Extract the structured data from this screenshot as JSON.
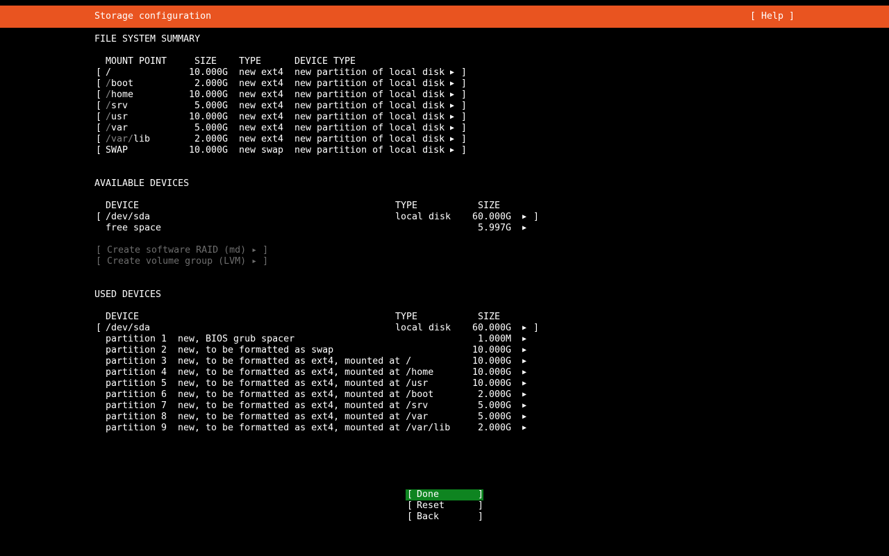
{
  "header": {
    "title": "Storage configuration",
    "help_label": "[ Help ]"
  },
  "fs_summary": {
    "title": "FILE SYSTEM SUMMARY",
    "columns": {
      "mount": "MOUNT POINT",
      "size": "SIZE",
      "type": "TYPE",
      "device_type": "DEVICE TYPE"
    },
    "rows": [
      {
        "mount_parts": [
          [
            "/",
            false
          ]
        ],
        "size": "10.000G",
        "type": "new ext4",
        "device_type": "new partition of local disk"
      },
      {
        "mount_parts": [
          [
            "/",
            true
          ],
          [
            "boot",
            false
          ]
        ],
        "size": "2.000G",
        "type": "new ext4",
        "device_type": "new partition of local disk"
      },
      {
        "mount_parts": [
          [
            "/",
            true
          ],
          [
            "home",
            false
          ]
        ],
        "size": "10.000G",
        "type": "new ext4",
        "device_type": "new partition of local disk"
      },
      {
        "mount_parts": [
          [
            "/",
            true
          ],
          [
            "srv",
            false
          ]
        ],
        "size": "5.000G",
        "type": "new ext4",
        "device_type": "new partition of local disk"
      },
      {
        "mount_parts": [
          [
            "/",
            true
          ],
          [
            "usr",
            false
          ]
        ],
        "size": "10.000G",
        "type": "new ext4",
        "device_type": "new partition of local disk"
      },
      {
        "mount_parts": [
          [
            "/",
            true
          ],
          [
            "var",
            false
          ]
        ],
        "size": "5.000G",
        "type": "new ext4",
        "device_type": "new partition of local disk"
      },
      {
        "mount_parts": [
          [
            "/var/",
            true
          ],
          [
            "lib",
            false
          ]
        ],
        "size": "2.000G",
        "type": "new ext4",
        "device_type": "new partition of local disk"
      },
      {
        "mount_parts": [
          [
            "SWAP",
            false
          ]
        ],
        "size": "10.000G",
        "type": "new swap",
        "device_type": "new partition of local disk"
      }
    ]
  },
  "available": {
    "title": "AVAILABLE DEVICES",
    "columns": {
      "device": "DEVICE",
      "type": "TYPE",
      "size": "SIZE"
    },
    "disk": {
      "device": "/dev/sda",
      "type": "local disk",
      "size": "60.000G"
    },
    "free": {
      "label": "free space",
      "size": "5.997G"
    },
    "raid_label": "[ Create software RAID (md) ▸ ]",
    "lvm_label": "[ Create volume group (LVM) ▸ ]"
  },
  "used": {
    "title": "USED DEVICES",
    "columns": {
      "device": "DEVICE",
      "type": "TYPE",
      "size": "SIZE"
    },
    "disk": {
      "device": "/dev/sda",
      "type": "local disk",
      "size": "60.000G"
    },
    "partitions": [
      {
        "name": "partition 1",
        "desc": "new, BIOS grub spacer",
        "size": "1.000M"
      },
      {
        "name": "partition 2",
        "desc": "new, to be formatted as swap",
        "size": "10.000G"
      },
      {
        "name": "partition 3",
        "desc": "new, to be formatted as ext4, mounted at /",
        "size": "10.000G"
      },
      {
        "name": "partition 4",
        "desc": "new, to be formatted as ext4, mounted at /home",
        "size": "10.000G"
      },
      {
        "name": "partition 5",
        "desc": "new, to be formatted as ext4, mounted at /usr",
        "size": "10.000G"
      },
      {
        "name": "partition 6",
        "desc": "new, to be formatted as ext4, mounted at /boot",
        "size": "2.000G"
      },
      {
        "name": "partition 7",
        "desc": "new, to be formatted as ext4, mounted at /srv",
        "size": "5.000G"
      },
      {
        "name": "partition 8",
        "desc": "new, to be formatted as ext4, mounted at /var",
        "size": "5.000G"
      },
      {
        "name": "partition 9",
        "desc": "new, to be formatted as ext4, mounted at /var/lib",
        "size": "2.000G"
      }
    ]
  },
  "buttons": {
    "done": "Done",
    "reset": "Reset",
    "back": "Back"
  },
  "glyphs": {
    "open": "[",
    "close": "]",
    "arrow": "▶"
  },
  "colors": {
    "header_bg": "#e95420",
    "focus_bg": "#0e8420",
    "text": "#ffffff",
    "dim_text": "#8a8a8a"
  }
}
